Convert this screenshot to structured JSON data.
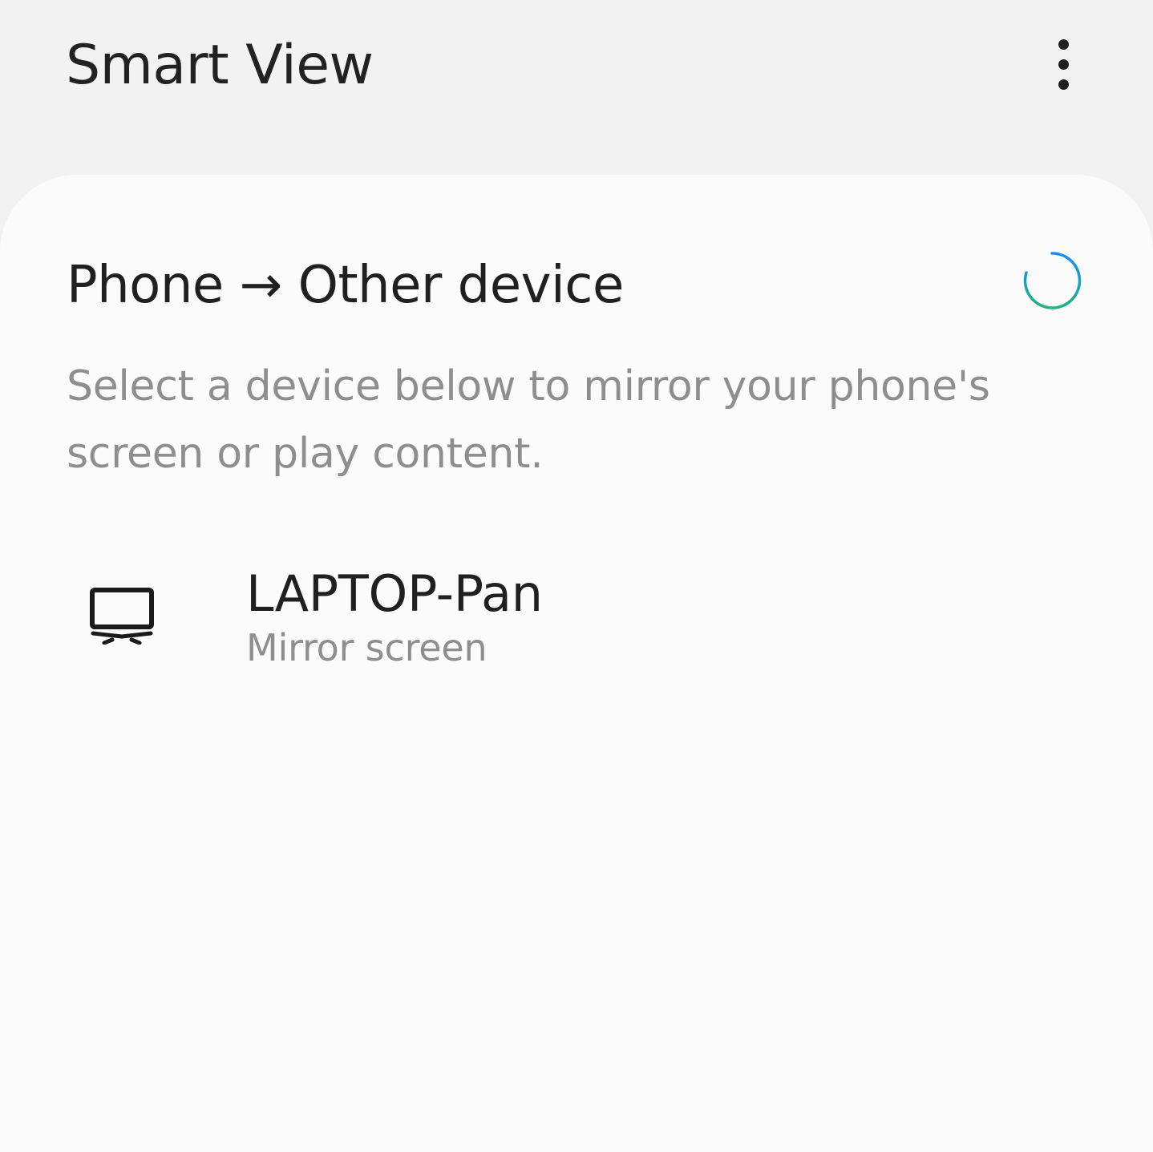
{
  "app_bar": {
    "title": "Smart View",
    "more_options_icon": "more-vertical-icon"
  },
  "section": {
    "title": "Phone → Other device",
    "description": "Select a device below to mirror your phone's screen or play content.",
    "scanning_indicator": "loading-spinner-icon"
  },
  "devices": [
    {
      "name": "LAPTOP-Pan",
      "status": "Mirror screen",
      "icon": "monitor-icon"
    }
  ],
  "colors": {
    "background": "#f2f2f2",
    "card": "#fbfbfb",
    "primary_text": "#202020",
    "secondary_text": "#8e8e8e",
    "spinner_blue": "#1a8cff",
    "spinner_green": "#1db57a"
  }
}
